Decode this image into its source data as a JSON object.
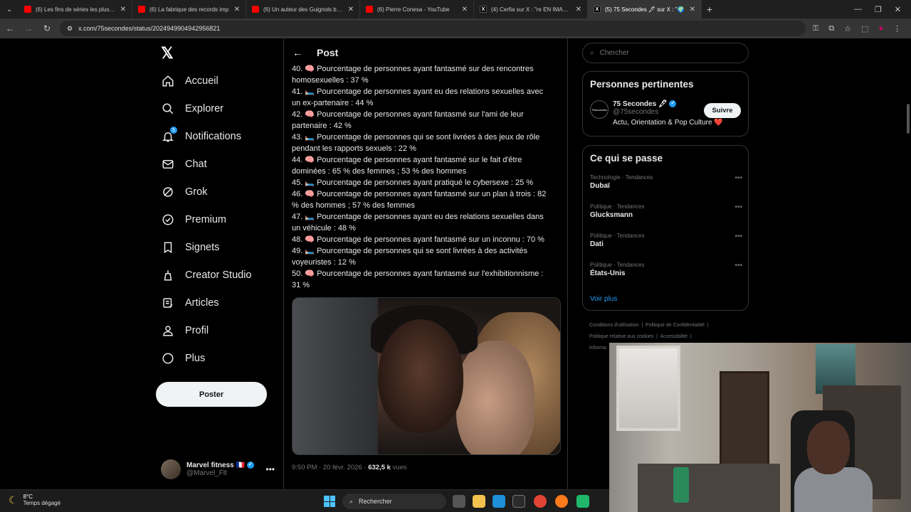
{
  "browser": {
    "tabs": [
      {
        "label": "(6) Les fins de séries les plus W",
        "icon": "youtube-icon"
      },
      {
        "label": "(6) La fabrique des records imp",
        "icon": "youtube-icon"
      },
      {
        "label": "(6) Un auteur des Guignols bala",
        "icon": "youtube-icon"
      },
      {
        "label": "(6) Pierre Conesa - YouTube",
        "icon": "youtube-icon"
      },
      {
        "label": "(4) Cerfia sur X : \"re EN IMAGES",
        "icon": "x-icon"
      },
      {
        "label": "(5) 75 Secondes 🖋 sur X : \"🌍",
        "icon": "x-icon",
        "active": true
      }
    ],
    "url": "x.com/75secondes/status/2024949904942956821"
  },
  "nav": {
    "items": [
      {
        "label": "Accueil",
        "icon": "home-icon"
      },
      {
        "label": "Explorer",
        "icon": "search-icon"
      },
      {
        "label": "Notifications",
        "icon": "bell-icon",
        "badge": "5"
      },
      {
        "label": "Chat",
        "icon": "mail-icon"
      },
      {
        "label": "Grok",
        "icon": "grok-icon"
      },
      {
        "label": "Premium",
        "icon": "premium-icon"
      },
      {
        "label": "Signets",
        "icon": "bookmark-icon"
      },
      {
        "label": "Creator Studio",
        "icon": "creator-icon"
      },
      {
        "label": "Articles",
        "icon": "articles-icon"
      },
      {
        "label": "Profil",
        "icon": "profile-icon"
      },
      {
        "label": "Plus",
        "icon": "more-icon"
      }
    ],
    "post_button": "Poster",
    "account": {
      "name": "Marvel fitness 🇫🇷",
      "handle": "@Marvel_Flt"
    }
  },
  "post": {
    "header": "Post",
    "lines": [
      "40. 🧠 Pourcentage de personnes ayant fantasmé sur des rencontres",
      "homosexuelles : 37 %",
      "41. 🛏️ Pourcentage de personnes ayant eu des relations sexuelles avec",
      "un ex-partenaire : 44 %",
      "42. 🧠 Pourcentage de personnes ayant fantasmé sur l'ami de leur",
      "partenaire : 42 %",
      "43. 🛏️ Pourcentage de personnes qui se sont livrées à des jeux de rôle",
      "pendant les rapports sexuels : 22 %",
      "44. 🧠 Pourcentage de personnes ayant fantasmé sur le fait d'être",
      "dominées : 65 % des femmes ; 53 % des hommes",
      "45. 🛏️ Pourcentage de personnes ayant pratiqué le cybersexe : 25 %",
      "46. 🧠 Pourcentage de personnes ayant fantasmé sur un plan à trois : 82",
      "% des hommes ; 57 % des femmes",
      "47. 🛏️ Pourcentage de personnes ayant eu des relations sexuelles dans",
      "un véhicule : 48 %",
      "48. 🧠 Pourcentage de personnes ayant fantasmé sur un inconnu : 70 %",
      "49. 🛏️ Pourcentage de personnes qui se sont livrées à des activités",
      "voyeuristes : 12 %",
      "50. 🧠 Pourcentage de personnes ayant fantasmé sur l'exhibitionnisme :",
      "31 %"
    ],
    "time": "9:50 PM · 20 févr. 2026 ·",
    "views_count": "632,5 k",
    "views_label": "vues"
  },
  "sidebar": {
    "search_placeholder": "Chercher",
    "relevant": {
      "title": "Personnes pertinentes",
      "name": "75 Secondes 🖋",
      "handle": "@75secondes",
      "bio": "Actu, Orientation & Pop Culture ❤️",
      "follow": "Suivre",
      "avatar_text": "75secondes"
    },
    "trends": {
      "title": "Ce qui se passe",
      "items": [
        {
          "category": "Technologie · Tendances",
          "name": "Dubaï"
        },
        {
          "category": "Politique · Tendances",
          "name": "Glucksmann"
        },
        {
          "category": "Politique · Tendances",
          "name": "Dati"
        },
        {
          "category": "Politique · Tendances",
          "name": "États-Unis"
        }
      ],
      "more": "Voir plus"
    },
    "footer": [
      "Conditions d'utilisation",
      "Politique de Confidentialité",
      "Politique relative aux cookies",
      "Accessibilité",
      "Informa"
    ]
  },
  "taskbar": {
    "temp": "8°C",
    "weather": "Temps dégagé",
    "search": "Rechercher"
  },
  "colors": {
    "accent": "#1d9bf0",
    "background": "#000000",
    "text": "#e7e9ea",
    "muted": "#71767b"
  }
}
